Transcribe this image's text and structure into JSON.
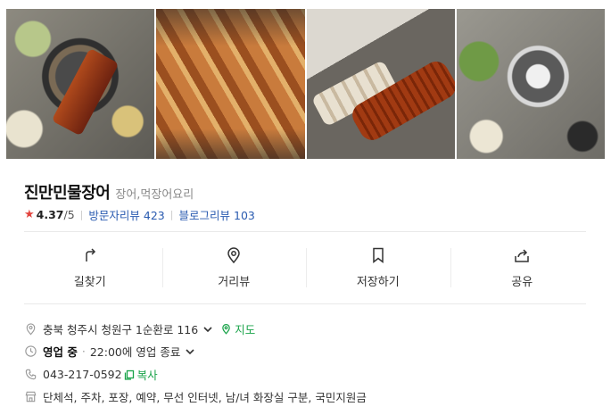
{
  "photos": [
    "장어 구이 상차림",
    "석쇠 위 장어구이",
    "집게로 집은 장어",
    "불판 상차림"
  ],
  "store": {
    "name": "진만민물장어",
    "category": "장어,먹장어요리",
    "rating": "4.37",
    "rating_max": "/5",
    "visitor_review_label": "방문자리뷰",
    "visitor_review_count": "423",
    "blog_review_label": "블로그리뷰",
    "blog_review_count": "103"
  },
  "actions": {
    "directions": "길찾기",
    "street_view": "거리뷰",
    "save": "저장하기",
    "share": "공유"
  },
  "info": {
    "address": "충북 청주시 청원구 1순환로 116",
    "map_label": "지도",
    "status": "영업 중",
    "hours": "22:00에 영업 종료",
    "phone": "043-217-0592",
    "copy_label": "복사",
    "amenities": "단체석, 주차, 포장, 예약, 무선 인터넷, 남/녀 화장실 구분, 국민지원금"
  },
  "colors": {
    "accent_green": "#1aa34a",
    "star_red": "#e2433d",
    "link_blue": "#2a5bb0"
  }
}
